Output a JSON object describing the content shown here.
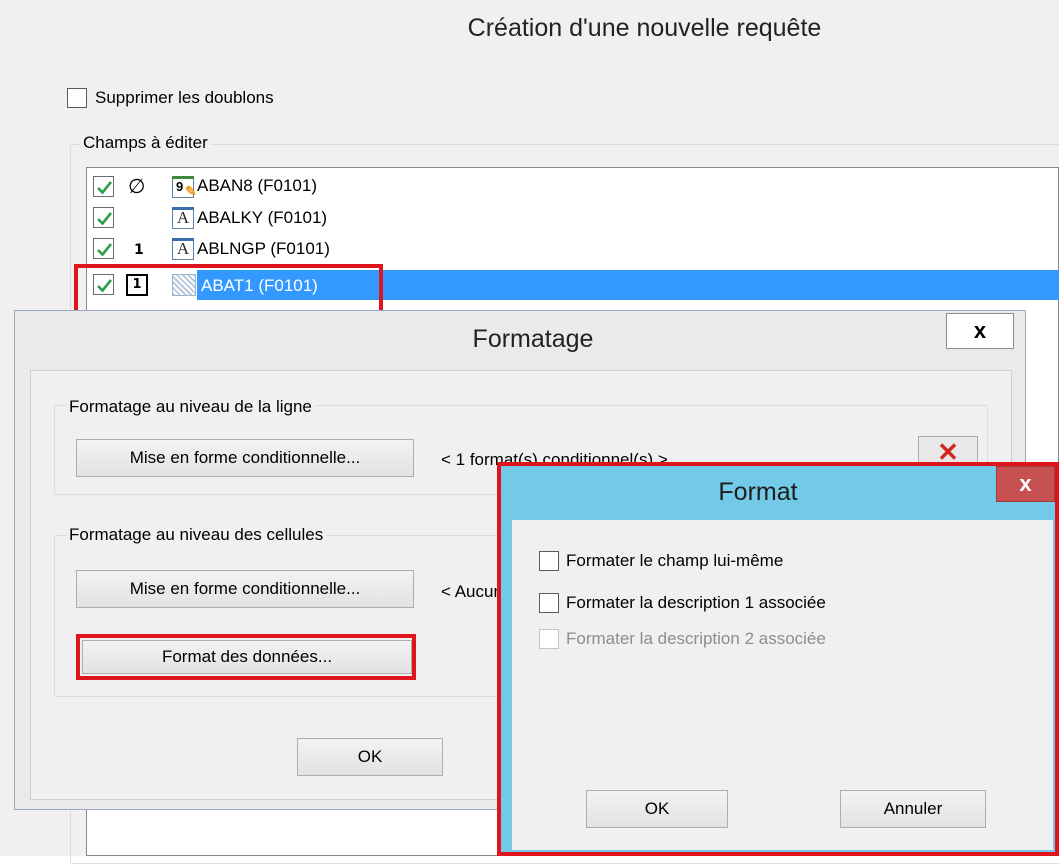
{
  "main_window": {
    "title": "Création d'une nouvelle requête",
    "remove_duplicates_label": "Supprimer les doublons",
    "fields_group_label": "Champs à éditer",
    "fields": [
      {
        "checked": true,
        "marker": "∅",
        "icon": "numeric-field-icon",
        "icon_text": "9",
        "label": "ABAN8 (F0101)"
      },
      {
        "checked": true,
        "marker": "",
        "icon": "alpha-field-icon",
        "icon_text": "A",
        "label": "ABALKY (F0101)"
      },
      {
        "checked": true,
        "marker": "1",
        "icon": "alpha-field-icon",
        "icon_text": "A",
        "label": "ABLNGP (F0101)"
      },
      {
        "checked": true,
        "marker": "1",
        "icon": "hatched-field-icon",
        "icon_text": "",
        "label": "ABAT1 (F0101)",
        "selected": true
      }
    ]
  },
  "formatage_dialog": {
    "title": "Formatage",
    "close_label": "x",
    "line_group_label": "Formatage au niveau de la ligne",
    "line_conditional_button": "Mise en forme conditionnelle...",
    "line_status": "< 1 format(s) conditionnel(s) >",
    "cell_group_label": "Formatage au niveau des cellules",
    "cell_conditional_button": "Mise en forme conditionnelle...",
    "cell_status": "< Aucun",
    "data_format_button": "Format des données...",
    "ok_button": "OK"
  },
  "format_dialog": {
    "title": "Format",
    "close_label": "x",
    "options": [
      {
        "label": "Formater le champ lui-même",
        "checked": false,
        "enabled": true
      },
      {
        "label": "Formater la description 1 associée",
        "checked": false,
        "enabled": true
      },
      {
        "label": "Formater la description 2 associée",
        "checked": false,
        "enabled": false
      }
    ],
    "ok_button": "OK",
    "cancel_button": "Annuler"
  },
  "colors": {
    "highlight_red": "#e0141e",
    "selection_blue": "#3399ff",
    "check_green": "#2e9e4e",
    "format_frame": "#72c9e8",
    "close_red": "#c75050"
  }
}
